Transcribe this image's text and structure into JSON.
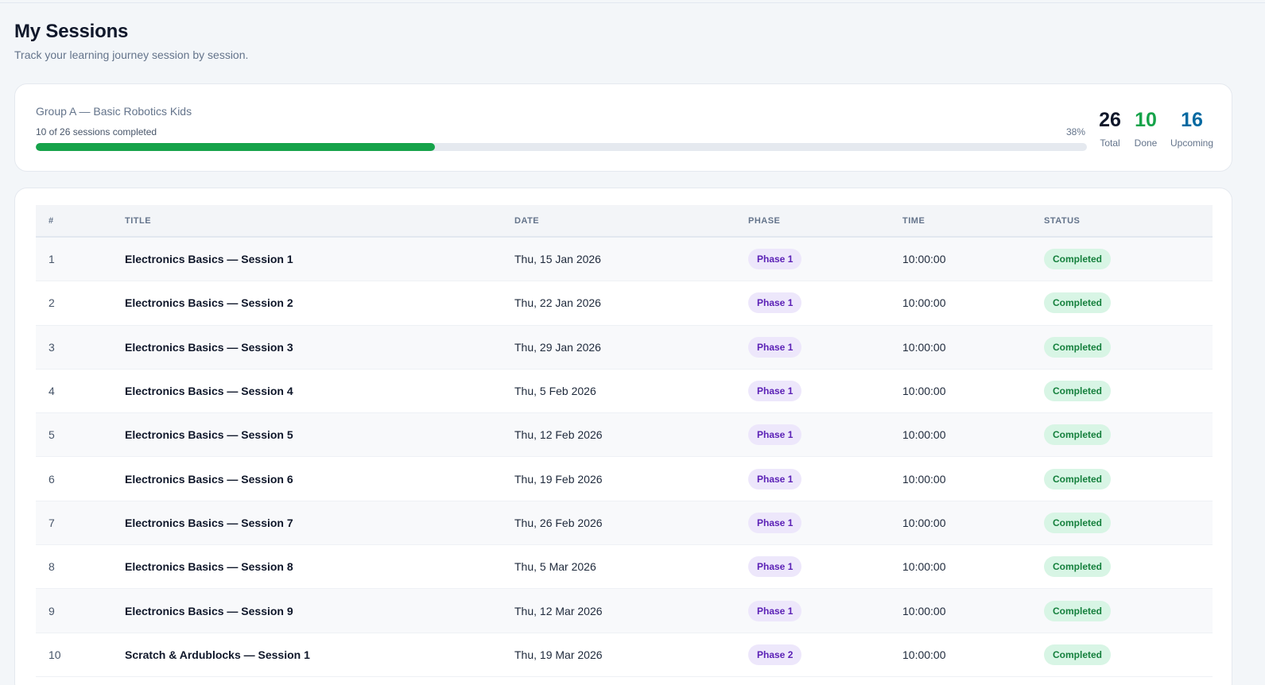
{
  "page": {
    "title": "My Sessions",
    "subtitle": "Track your learning journey session by session."
  },
  "summary": {
    "group_name": "Group A — Basic Robotics Kids",
    "progress_text": "10 of 26 sessions completed",
    "progress_percent_label": "38%",
    "progress_fraction": 0.38,
    "stats": {
      "total": {
        "value": "26",
        "label": "Total",
        "color": "#0f172a"
      },
      "done": {
        "value": "10",
        "label": "Done",
        "color": "#16a34a"
      },
      "upcoming": {
        "value": "16",
        "label": "Upcoming",
        "color": "#0369a1"
      }
    }
  },
  "table": {
    "headers": {
      "num": "#",
      "title": "TITLE",
      "date": "DATE",
      "phase": "PHASE",
      "time": "TIME",
      "status": "STATUS"
    },
    "rows": [
      {
        "num": "1",
        "title": "Electronics Basics — Session 1",
        "date": "Thu, 15 Jan 2026",
        "phase": "Phase 1",
        "time": "10:00:00",
        "status": "Completed"
      },
      {
        "num": "2",
        "title": "Electronics Basics — Session 2",
        "date": "Thu, 22 Jan 2026",
        "phase": "Phase 1",
        "time": "10:00:00",
        "status": "Completed"
      },
      {
        "num": "3",
        "title": "Electronics Basics — Session 3",
        "date": "Thu, 29 Jan 2026",
        "phase": "Phase 1",
        "time": "10:00:00",
        "status": "Completed"
      },
      {
        "num": "4",
        "title": "Electronics Basics — Session 4",
        "date": "Thu, 5 Feb 2026",
        "phase": "Phase 1",
        "time": "10:00:00",
        "status": "Completed"
      },
      {
        "num": "5",
        "title": "Electronics Basics — Session 5",
        "date": "Thu, 12 Feb 2026",
        "phase": "Phase 1",
        "time": "10:00:00",
        "status": "Completed"
      },
      {
        "num": "6",
        "title": "Electronics Basics — Session 6",
        "date": "Thu, 19 Feb 2026",
        "phase": "Phase 1",
        "time": "10:00:00",
        "status": "Completed"
      },
      {
        "num": "7",
        "title": "Electronics Basics — Session 7",
        "date": "Thu, 26 Feb 2026",
        "phase": "Phase 1",
        "time": "10:00:00",
        "status": "Completed"
      },
      {
        "num": "8",
        "title": "Electronics Basics — Session 8",
        "date": "Thu, 5 Mar 2026",
        "phase": "Phase 1",
        "time": "10:00:00",
        "status": "Completed"
      },
      {
        "num": "9",
        "title": "Electronics Basics — Session 9",
        "date": "Thu, 12 Mar 2026",
        "phase": "Phase 1",
        "time": "10:00:00",
        "status": "Completed"
      },
      {
        "num": "10",
        "title": "Scratch & Ardublocks — Session 1",
        "date": "Thu, 19 Mar 2026",
        "phase": "Phase 2",
        "time": "10:00:00",
        "status": "Completed"
      }
    ]
  }
}
